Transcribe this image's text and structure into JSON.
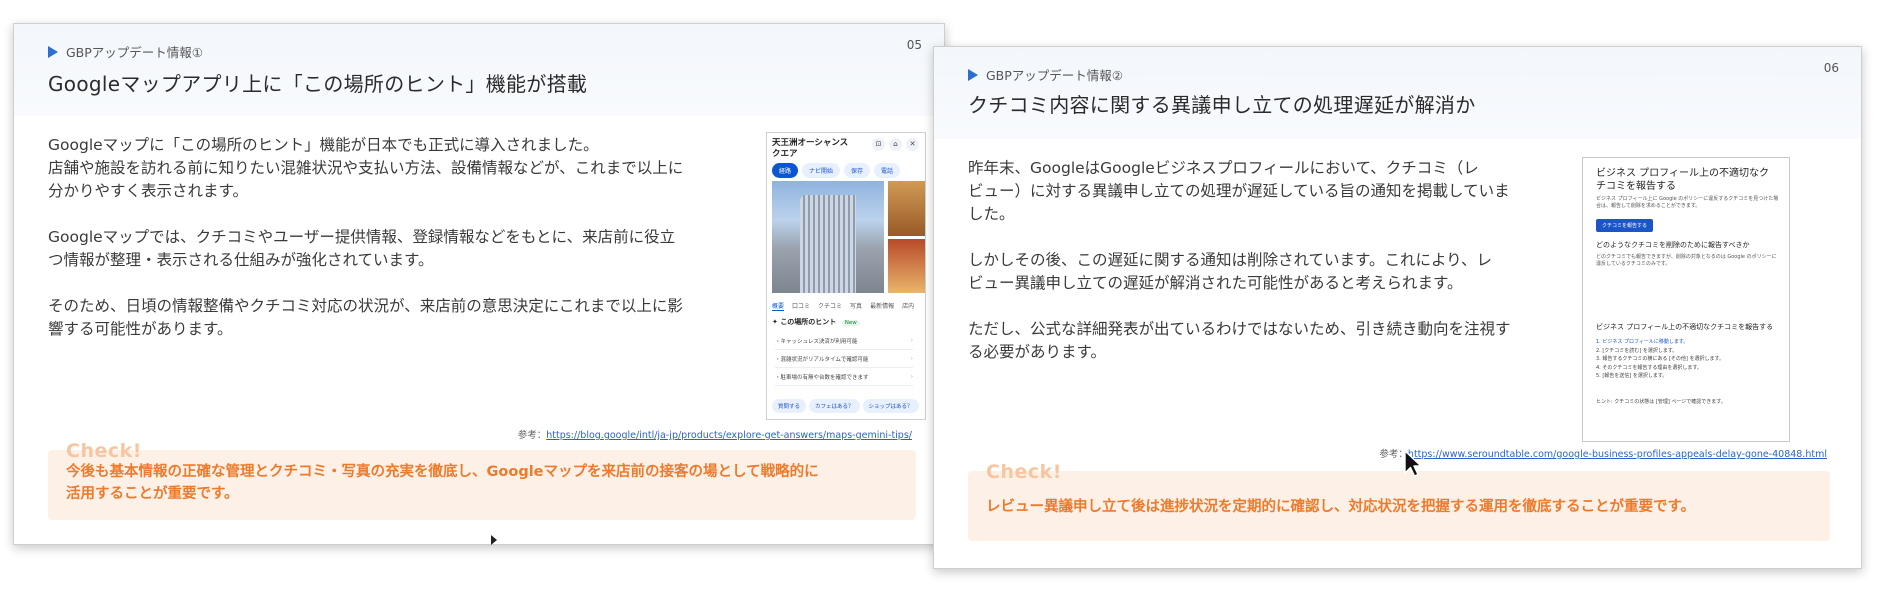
{
  "slides": [
    {
      "tag": "GBPアップデート情報①",
      "page_number": "05",
      "title": "Googleマップアプリ上に「この場所のヒント」機能が搭載",
      "paragraphs": [
        "Googleマップに「この場所のヒント」機能が日本でも正式に導入されました。\n店舗や施設を訪れる前に知りたい混雑状況や支払い方法、設備情報などが、これまで以上に\n分かりやすく表示されます。",
        "Googleマップでは、クチコミやユーザー提供情報、登録情報などをもとに、来店前に役立\nつ情報が整理・表示される仕組みが強化されています。",
        "そのため、日頃の情報整備やクチコミ対応の状況が、来店前の意思決定にこれまで以上に影\n響する可能性があります。"
      ],
      "reference_prefix": "参考：",
      "reference_url": "https://blog.google/intl/ja-jp/products/explore-get-answers/maps-gemini-tips/",
      "check_label": "Check!",
      "check_text": "今後も基本情報の正確な管理とクチコミ・写真の充実を徹底し、Googleマップを来店前の接客の場として戦略的に\n活用することが重要です。",
      "screenshot": {
        "title": "天王洲オーシャンスクエア",
        "chips": [
          "経路",
          "ナビ開始",
          "保存",
          "電話"
        ],
        "tabs": [
          "概要",
          "口コミ",
          "クチコミ",
          "写真",
          "最新情報",
          "店内"
        ],
        "hint_heading": "この場所のヒント",
        "hint_badge": "New",
        "hints": [
          "・キャッシュレス決済が利用可能",
          "・混雑状況がリアルタイムで確認可能",
          "・駐車場の有無や台数を確認できます"
        ],
        "buttons": [
          "質問する",
          "カフェはある？",
          "ショップはある？"
        ]
      }
    },
    {
      "tag": "GBPアップデート情報②",
      "page_number": "06",
      "title": "クチコミ内容に関する異議申し立ての処理遅延が解消か",
      "paragraphs": [
        "昨年末、GoogleはGoogleビジネスプロフィールにおいて、クチコミ（レ\nビュー）に対する異議申し立ての処理が遅延している旨の通知を掲載していま\nした。",
        "しかしその後、この遅延に関する通知は削除されています。これにより、レ\nビュー異議申し立ての遅延が解消された可能性があると考えられます。",
        "ただし、公式な詳細発表が出ているわけではないため、引き続き動向を注視す\nる必要があります。"
      ],
      "reference_prefix": "参考：",
      "reference_url": "https://www.seroundtable.com/google-business-profiles-appeals-delay-gone-40848.html",
      "check_label": "Check!",
      "check_text": "レビュー異議申し立て後は進捗状況を定期的に確認し、対応状況を把握する運用を徹底することが重要です。",
      "screenshot": {
        "heading": "ビジネス プロフィール上の不適切なクチコミを報告する",
        "intro": "ビジネス プロフィール上に Google のポリシーに違反するクチコミを見つけた場合は、報告して削除を求めることができます。",
        "button": "クチコミを報告する",
        "subheading1": "どのようなクチコミを削除のために報告すべきか",
        "body1": "どのクチコミでも報告できますが、削除の対象となるのは Google のポリシーに違反しているクチコミのみです。",
        "subheading2": "ビジネス プロフィール上の不適切なクチコミを報告する",
        "steps": [
          "1. ビジネス プロフィールに移動します。",
          "2. [クチコミを読む] を選択します。",
          "3. 報告するクチコミの横にある [その他] を選択します。",
          "4. そのクチコミを報告する理由を選択します。",
          "5. [報告を送信] を選択します。"
        ],
        "hint": "ヒント: クチコミの状態は [管理] ページで確認できます。"
      }
    }
  ]
}
